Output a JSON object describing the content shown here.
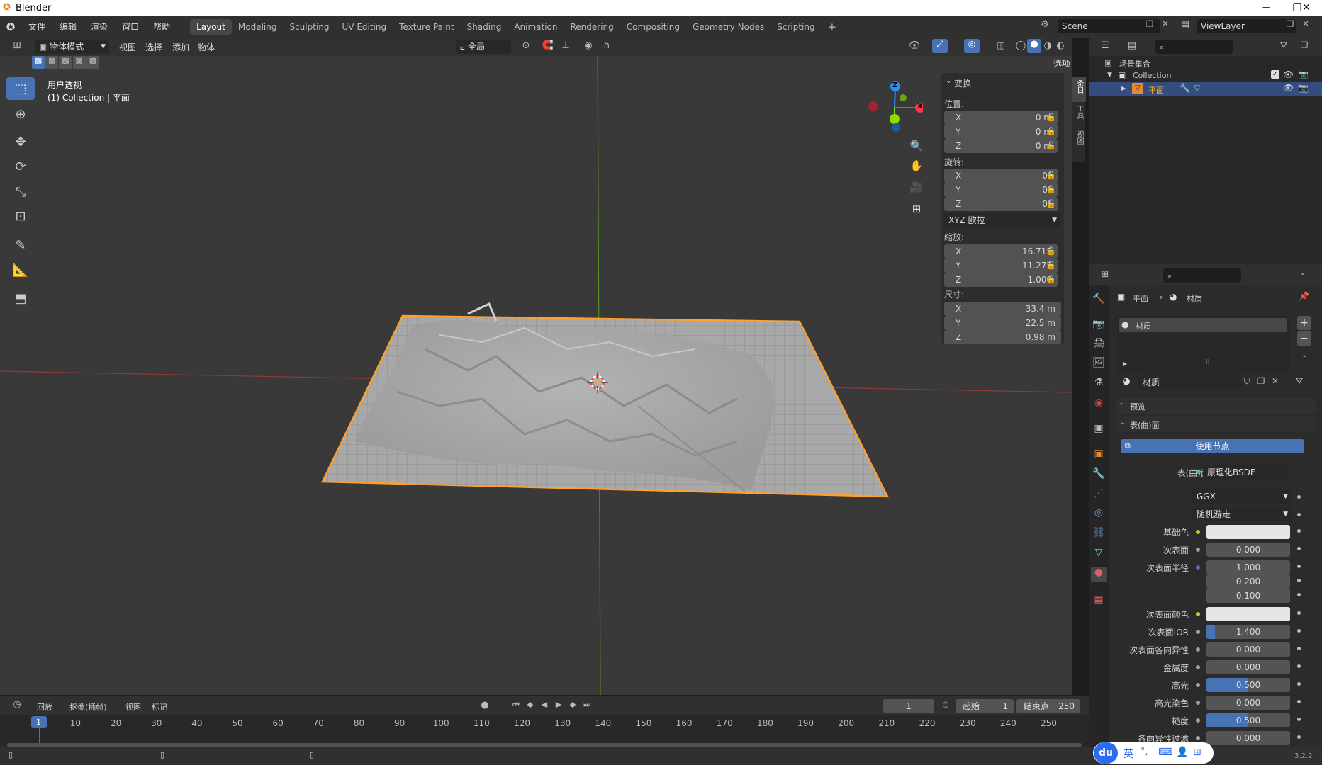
{
  "window": {
    "title": "Blender",
    "minimize": "─",
    "restore": "❐",
    "close": "✕"
  },
  "topbar": {
    "menus": [
      "文件",
      "编辑",
      "渲染",
      "窗口",
      "帮助"
    ],
    "workspaces": [
      "Layout",
      "Modeling",
      "Sculpting",
      "UV Editing",
      "Texture Paint",
      "Shading",
      "Animation",
      "Rendering",
      "Compositing",
      "Geometry Nodes",
      "Scripting"
    ],
    "add_tab": "+",
    "scene": "Scene",
    "view_layer": "ViewLayer"
  },
  "viewport": {
    "mode": "物体模式",
    "menus": [
      "视图",
      "选择",
      "添加",
      "物体"
    ],
    "orientation": "全局",
    "options": "选项",
    "view_name": "用户透视",
    "object_info": "(1) Collection | 平面",
    "gizmo": {
      "z": "Z",
      "y": "Y",
      "x": "X"
    }
  },
  "npanel": {
    "section": "变换",
    "location_label": "位置:",
    "location": {
      "x": "0 m",
      "y": "0 m",
      "z": "0 m"
    },
    "rotation_label": "旋转:",
    "rotation": {
      "x": "0°",
      "y": "0°",
      "z": "0°"
    },
    "rotation_mode": "XYZ 欧拉",
    "scale_label": "缩放:",
    "scale": {
      "x": "16.715",
      "y": "11.275",
      "z": "1.000"
    },
    "dimensions_label": "尺寸:",
    "dimensions": {
      "x": "33.4 m",
      "y": "22.5 m",
      "z": "0.98 m"
    },
    "axes": {
      "x": "X",
      "y": "Y",
      "z": "Z"
    },
    "tabs": [
      "条目",
      "工具",
      "视图"
    ]
  },
  "outliner": {
    "scene_collection": "场景集合",
    "collection": "Collection",
    "object": "平面"
  },
  "properties": {
    "breadcrumb_object": "平面",
    "breadcrumb_material": "材质",
    "slot": "材质",
    "material_name": "材质",
    "preview": "预览",
    "surface": "表(曲)面",
    "use_nodes": "使用节点",
    "surface_label": "表(曲)面",
    "surface_shader": "原理化BSDF",
    "distribution": "GGX",
    "subsurface_method": "随机游走",
    "rows": [
      {
        "label": "基础色",
        "value": "",
        "dot": "#c7c729",
        "fill": 0,
        "color": "#e6e6e6"
      },
      {
        "label": "次表面",
        "value": "0.000",
        "dot": "#a1a1a1",
        "fill": 0
      },
      {
        "label": "次表面半径",
        "value": "1.000",
        "dot": "#6363c7",
        "fill": 0
      },
      {
        "label": "",
        "value": "0.200",
        "dot": "",
        "fill": 0
      },
      {
        "label": "",
        "value": "0.100",
        "dot": "",
        "fill": 0
      },
      {
        "label": "次表面颜色",
        "value": "",
        "dot": "#c7c729",
        "fill": 0,
        "color": "#e6e6e6"
      },
      {
        "label": "次表面IOR",
        "value": "1.400",
        "dot": "#a1a1a1",
        "fill": 0.1
      },
      {
        "label": "次表面各向异性",
        "value": "0.000",
        "dot": "#a1a1a1",
        "fill": 0
      },
      {
        "label": "金属度",
        "value": "0.000",
        "dot": "#a1a1a1",
        "fill": 0
      },
      {
        "label": "高光",
        "value": "0.500",
        "dot": "#a1a1a1",
        "fill": 0.5
      },
      {
        "label": "高光染色",
        "value": "0.000",
        "dot": "#a1a1a1",
        "fill": 0
      },
      {
        "label": "糙度",
        "value": "0.500",
        "dot": "#a1a1a1",
        "fill": 0.5
      },
      {
        "label": "各向异性过滤",
        "value": "0.000",
        "dot": "#a1a1a1",
        "fill": 0
      }
    ]
  },
  "timeline": {
    "menus": [
      "回放",
      "抠像(插帧)",
      "视图",
      "标记"
    ],
    "current_frame": "1",
    "start_label": "起始",
    "start": "1",
    "end_label": "结束点",
    "end": "250",
    "ticks": [
      "1",
      "10",
      "20",
      "30",
      "40",
      "50",
      "60",
      "70",
      "80",
      "90",
      "100",
      "110",
      "120",
      "130",
      "140",
      "150",
      "160",
      "170",
      "180",
      "190",
      "200",
      "210",
      "220",
      "230",
      "240",
      "250"
    ]
  },
  "status": {
    "version": "3.2.2"
  },
  "ime": {
    "logo": "du",
    "lang": "英",
    "punct": "°,"
  },
  "colors": {
    "accent": "#4772b3",
    "selected": "#ffa031",
    "x_axis": "#ff3352",
    "y_axis": "#8bdc00",
    "z_axis": "#2890ff"
  }
}
